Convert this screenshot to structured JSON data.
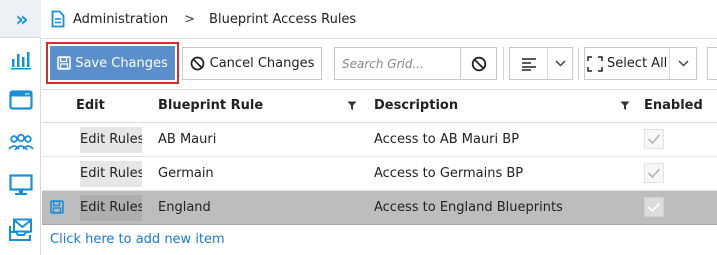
{
  "breadcrumb": {
    "root": "Administration",
    "separator": ">",
    "current": "Blueprint Access Rules"
  },
  "toolbar": {
    "save_label": "Save Changes",
    "cancel_label": "Cancel Changes",
    "search_placeholder": "Search Grid...",
    "select_all_label": "Select All"
  },
  "grid": {
    "columns": {
      "edit": "Edit",
      "rule": "Blueprint Rule",
      "description": "Description",
      "enabled": "Enabled"
    },
    "rows": [
      {
        "edit": "Edit Rules",
        "rule": "AB Mauri",
        "description": "Access to AB Mauri BP",
        "enabled": true,
        "selected": false
      },
      {
        "edit": "Edit Rules",
        "rule": "Germain",
        "description": "Access to Germains BP",
        "enabled": true,
        "selected": false
      },
      {
        "edit": "Edit Rules",
        "rule": "England",
        "description": "Access to England Blueprints",
        "enabled": true,
        "selected": true,
        "modified": true
      }
    ],
    "add_new_label": "Click here to add new item"
  },
  "icons": {
    "expander": "double-chevron-right-icon",
    "rail": [
      "bar-chart-icon",
      "window-icon",
      "users-icon",
      "monitor-icon",
      "envelope-tray-icon"
    ]
  },
  "colors": {
    "accent": "#1a8fd8",
    "save_button": "#5a8fcc",
    "highlight_border": "#d32f2f",
    "selected_row": "#bdbdbd",
    "link": "#1a7ad6"
  }
}
